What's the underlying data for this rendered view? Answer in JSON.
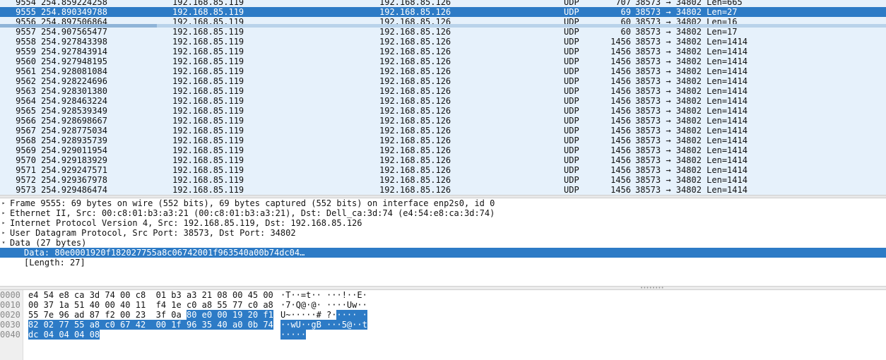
{
  "packets": [
    {
      "no": "9554",
      "time": "254.859224258",
      "src": "192.168.85.119",
      "dst": "192.168.85.126",
      "proto": "UDP",
      "len": "707",
      "info": "38573 → 34802 Len=665",
      "selected": false
    },
    {
      "no": "9555",
      "time": "254.890349788",
      "src": "192.168.85.119",
      "dst": "192.168.85.126",
      "proto": "UDP",
      "len": "69",
      "info": "38573 → 34802 Len=27",
      "selected": true
    },
    {
      "no": "9556",
      "time": "254.897506864",
      "src": "192.168.85.119",
      "dst": "192.168.85.126",
      "proto": "UDP",
      "len": "60",
      "info": "38573 → 34802 Len=16",
      "selected": false
    },
    {
      "no": "9557",
      "time": "254.907565477",
      "src": "192.168.85.119",
      "dst": "192.168.85.126",
      "proto": "UDP",
      "len": "60",
      "info": "38573 → 34802 Len=17",
      "selected": false
    },
    {
      "no": "9558",
      "time": "254.927843398",
      "src": "192.168.85.119",
      "dst": "192.168.85.126",
      "proto": "UDP",
      "len": "1456",
      "info": "38573 → 34802 Len=1414",
      "selected": false
    },
    {
      "no": "9559",
      "time": "254.927843914",
      "src": "192.168.85.119",
      "dst": "192.168.85.126",
      "proto": "UDP",
      "len": "1456",
      "info": "38573 → 34802 Len=1414",
      "selected": false
    },
    {
      "no": "9560",
      "time": "254.927948195",
      "src": "192.168.85.119",
      "dst": "192.168.85.126",
      "proto": "UDP",
      "len": "1456",
      "info": "38573 → 34802 Len=1414",
      "selected": false
    },
    {
      "no": "9561",
      "time": "254.928081084",
      "src": "192.168.85.119",
      "dst": "192.168.85.126",
      "proto": "UDP",
      "len": "1456",
      "info": "38573 → 34802 Len=1414",
      "selected": false
    },
    {
      "no": "9562",
      "time": "254.928224696",
      "src": "192.168.85.119",
      "dst": "192.168.85.126",
      "proto": "UDP",
      "len": "1456",
      "info": "38573 → 34802 Len=1414",
      "selected": false
    },
    {
      "no": "9563",
      "time": "254.928301380",
      "src": "192.168.85.119",
      "dst": "192.168.85.126",
      "proto": "UDP",
      "len": "1456",
      "info": "38573 → 34802 Len=1414",
      "selected": false
    },
    {
      "no": "9564",
      "time": "254.928463224",
      "src": "192.168.85.119",
      "dst": "192.168.85.126",
      "proto": "UDP",
      "len": "1456",
      "info": "38573 → 34802 Len=1414",
      "selected": false
    },
    {
      "no": "9565",
      "time": "254.928539349",
      "src": "192.168.85.119",
      "dst": "192.168.85.126",
      "proto": "UDP",
      "len": "1456",
      "info": "38573 → 34802 Len=1414",
      "selected": false
    },
    {
      "no": "9566",
      "time": "254.928698667",
      "src": "192.168.85.119",
      "dst": "192.168.85.126",
      "proto": "UDP",
      "len": "1456",
      "info": "38573 → 34802 Len=1414",
      "selected": false
    },
    {
      "no": "9567",
      "time": "254.928775034",
      "src": "192.168.85.119",
      "dst": "192.168.85.126",
      "proto": "UDP",
      "len": "1456",
      "info": "38573 → 34802 Len=1414",
      "selected": false
    },
    {
      "no": "9568",
      "time": "254.928935739",
      "src": "192.168.85.119",
      "dst": "192.168.85.126",
      "proto": "UDP",
      "len": "1456",
      "info": "38573 → 34802 Len=1414",
      "selected": false
    },
    {
      "no": "9569",
      "time": "254.929011954",
      "src": "192.168.85.119",
      "dst": "192.168.85.126",
      "proto": "UDP",
      "len": "1456",
      "info": "38573 → 34802 Len=1414",
      "selected": false
    },
    {
      "no": "9570",
      "time": "254.929183929",
      "src": "192.168.85.119",
      "dst": "192.168.85.126",
      "proto": "UDP",
      "len": "1456",
      "info": "38573 → 34802 Len=1414",
      "selected": false
    },
    {
      "no": "9571",
      "time": "254.929247571",
      "src": "192.168.85.119",
      "dst": "192.168.85.126",
      "proto": "UDP",
      "len": "1456",
      "info": "38573 → 34802 Len=1414",
      "selected": false
    },
    {
      "no": "9572",
      "time": "254.929367978",
      "src": "192.168.85.119",
      "dst": "192.168.85.126",
      "proto": "UDP",
      "len": "1456",
      "info": "38573 → 34802 Len=1414",
      "selected": false
    },
    {
      "no": "9573",
      "time": "254.929486474",
      "src": "192.168.85.119",
      "dst": "192.168.85.126",
      "proto": "UDP",
      "len": "1456",
      "info": "38573 → 34802 Len=1414",
      "selected": false
    }
  ],
  "details": [
    {
      "text": "Frame 9555: 69 bytes on wire (552 bits), 69 bytes captured (552 bits) on interface enp2s0, id 0",
      "level": 0,
      "expander": "collapsed",
      "selected": false
    },
    {
      "text": "Ethernet II, Src: 00:c8:01:b3:a3:21 (00:c8:01:b3:a3:21), Dst: Dell_ca:3d:74 (e4:54:e8:ca:3d:74)",
      "level": 0,
      "expander": "collapsed",
      "selected": false
    },
    {
      "text": "Internet Protocol Version 4, Src: 192.168.85.119, Dst: 192.168.85.126",
      "level": 0,
      "expander": "collapsed",
      "selected": false
    },
    {
      "text": "User Datagram Protocol, Src Port: 38573, Dst Port: 34802",
      "level": 0,
      "expander": "collapsed",
      "selected": false
    },
    {
      "text": "Data (27 bytes)",
      "level": 0,
      "expander": "expanded",
      "selected": false
    },
    {
      "text": "Data: 80e0001920f182027755a8c06742001f963540a00b74dc04…",
      "level": 1,
      "expander": "none",
      "selected": true
    },
    {
      "text": "[Length: 27]",
      "level": 1,
      "expander": "none",
      "selected": false
    }
  ],
  "bytes": [
    {
      "offset": "0000",
      "hex_plain": "e4 54 e8 ca 3d 74 00 c8  01 b3 a3 21 08 00 45 00",
      "hex_hl": "",
      "ascii_plain": "·T··=t·· ···!··E·",
      "ascii_hl": ""
    },
    {
      "offset": "0010",
      "hex_plain": "00 37 1a 51 40 00 40 11  f4 1e c0 a8 55 77 c0 a8",
      "hex_hl": "",
      "ascii_plain": "·7·Q@·@· ····Uw··",
      "ascii_hl": ""
    },
    {
      "offset": "0020",
      "hex_plain": "55 7e 96 ad 87 f2 00 23  3f 0a ",
      "hex_hl": "80 e0 00 19 20 f1",
      "ascii_plain": "U~·····# ?·",
      "ascii_hl": "···· ·"
    },
    {
      "offset": "0030",
      "hex_plain": "",
      "hex_hl": "82 02 77 55 a8 c0 67 42  00 1f 96 35 40 a0 0b 74",
      "ascii_plain": "",
      "ascii_hl": "··wU··gB ···5@··t"
    },
    {
      "offset": "0040",
      "hex_plain": "",
      "hex_hl": "dc 04 04 04 08",
      "ascii_plain": "",
      "ascii_hl": "·····"
    }
  ],
  "colors": {
    "row_bg": "#e6f1fb",
    "selection": "#2d7bc6"
  },
  "icons": {
    "collapsed": "▸",
    "expanded": "▾"
  }
}
